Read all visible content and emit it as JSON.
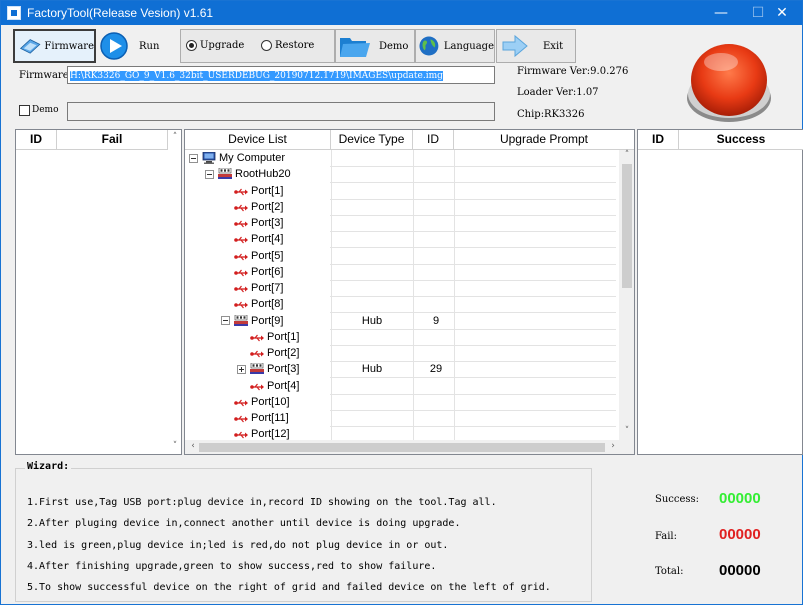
{
  "window": {
    "title": "FactoryTool(Release Vesion) v1.61",
    "minimize": "—",
    "maximize": "☐",
    "close": "✕"
  },
  "toolbar": {
    "firmware": "Firmware",
    "run": "Run",
    "upgrade": "Upgrade",
    "restore": "Restore",
    "demo": "Demo",
    "language": "Language",
    "exit": "Exit",
    "mode_selected": "Upgrade"
  },
  "firmware": {
    "label": "Firmware",
    "path": "H:\\RK3326_GO_9_V1.6_32bit_USERDEBUG_20190712.1719\\IMAGES\\update.img",
    "firmware_ver": "Firmware Ver:9.0.276",
    "loader_ver": "Loader Ver:1.07",
    "chip": "Chip:RK3326"
  },
  "demo": {
    "label": "Demo",
    "checked": false
  },
  "fail_grid": {
    "headers": [
      "ID",
      "Fail"
    ]
  },
  "success_grid": {
    "headers": [
      "ID",
      "Success"
    ]
  },
  "device_grid": {
    "headers": [
      "Device List",
      "Device Type",
      "ID",
      "Upgrade Prompt"
    ],
    "rows": [
      {
        "label": "My Computer",
        "icon": "computer-icon",
        "level": 0,
        "expander": "minus",
        "type": "",
        "id": ""
      },
      {
        "label": "RootHub20",
        "icon": "hub-icon",
        "level": 1,
        "expander": "minus",
        "type": "",
        "id": ""
      },
      {
        "label": "Port[1]",
        "icon": "usb-icon",
        "level": 2,
        "expander": "",
        "type": "",
        "id": ""
      },
      {
        "label": "Port[2]",
        "icon": "usb-icon",
        "level": 2,
        "expander": "",
        "type": "",
        "id": ""
      },
      {
        "label": "Port[3]",
        "icon": "usb-icon",
        "level": 2,
        "expander": "",
        "type": "",
        "id": ""
      },
      {
        "label": "Port[4]",
        "icon": "usb-icon",
        "level": 2,
        "expander": "",
        "type": "",
        "id": ""
      },
      {
        "label": "Port[5]",
        "icon": "usb-icon",
        "level": 2,
        "expander": "",
        "type": "",
        "id": ""
      },
      {
        "label": "Port[6]",
        "icon": "usb-icon",
        "level": 2,
        "expander": "",
        "type": "",
        "id": ""
      },
      {
        "label": "Port[7]",
        "icon": "usb-icon",
        "level": 2,
        "expander": "",
        "type": "",
        "id": ""
      },
      {
        "label": "Port[8]",
        "icon": "usb-icon",
        "level": 2,
        "expander": "",
        "type": "",
        "id": ""
      },
      {
        "label": "Port[9]",
        "icon": "hub-icon",
        "level": 2,
        "expander": "minus",
        "type": "Hub",
        "id": "9"
      },
      {
        "label": "Port[1]",
        "icon": "usb-icon",
        "level": 3,
        "expander": "",
        "type": "",
        "id": ""
      },
      {
        "label": "Port[2]",
        "icon": "usb-icon",
        "level": 3,
        "expander": "",
        "type": "",
        "id": ""
      },
      {
        "label": "Port[3]",
        "icon": "hub-icon",
        "level": 3,
        "expander": "plus",
        "type": "Hub",
        "id": "29"
      },
      {
        "label": "Port[4]",
        "icon": "usb-icon",
        "level": 3,
        "expander": "",
        "type": "",
        "id": ""
      },
      {
        "label": "Port[10]",
        "icon": "usb-icon",
        "level": 2,
        "expander": "",
        "type": "",
        "id": ""
      },
      {
        "label": "Port[11]",
        "icon": "usb-icon",
        "level": 2,
        "expander": "",
        "type": "",
        "id": ""
      },
      {
        "label": "Port[12]",
        "icon": "usb-icon",
        "level": 2,
        "expander": "",
        "type": "",
        "id": ""
      }
    ]
  },
  "wizard": {
    "title": "Wizard:",
    "lines": [
      "1.First use,Tag USB port:plug device in,record ID showing on the tool.Tag all.",
      "2.After pluging device in,connect another until device is doing upgrade.",
      "3.led is green,plug device in;led is red,do not plug device in or out.",
      "4.After finishing upgrade,green to show success,red to show failure.",
      "5.To show successful device on the right of grid and failed device on the left of grid."
    ]
  },
  "stats": {
    "success_label": "Success:",
    "success_value": "00000",
    "fail_label": "Fail:",
    "fail_value": "00000",
    "total_label": "Total:",
    "total_value": "00000"
  },
  "colors": {
    "titlebar": "#0f6fd4",
    "success": "#33ee33",
    "fail": "#e02020",
    "selection": "#3399ff",
    "usb": "#d21e1e",
    "status_button": "#e8401c"
  }
}
